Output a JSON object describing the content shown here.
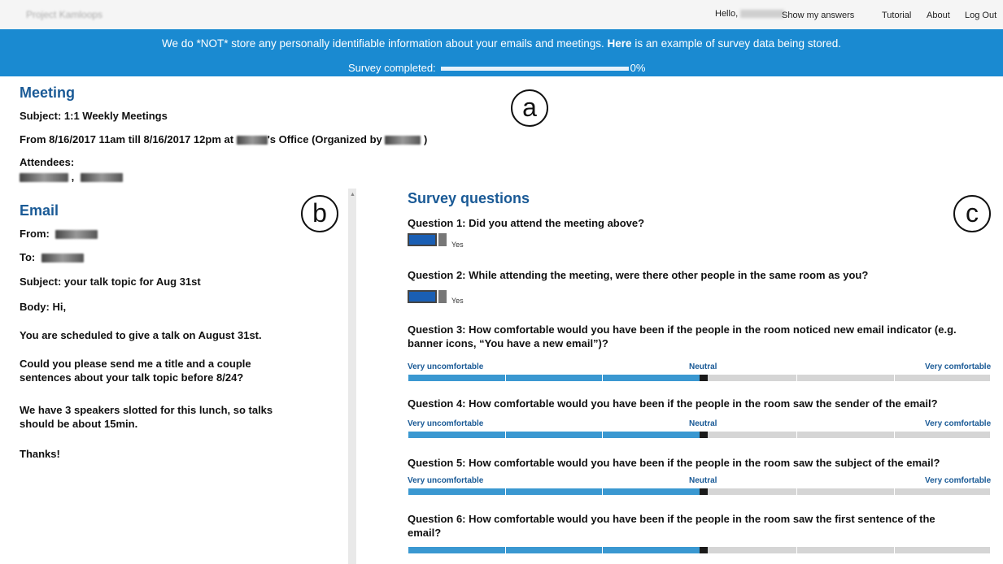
{
  "nav": {
    "brand": "Project Kamloops",
    "hello": "Hello,",
    "links": [
      "Show my answers",
      "Tutorial",
      "About",
      "Log Out"
    ]
  },
  "banner": {
    "notice_pre": "We do *NOT* store any personally identifiable information about your emails and meetings. ",
    "notice_link": "Here",
    "notice_post": " is an example of survey data being stored.",
    "progress_label": "Survey completed:",
    "progress_value": "0%",
    "progress_fraction": 0.0
  },
  "meeting": {
    "title": "Meeting",
    "subject": "Subject: 1:1 Weekly Meetings",
    "from_pre": "From 8/16/2017 11am till 8/16/2017 12pm at",
    "from_office": "'s Office (Organized by",
    "from_close": ")",
    "attendees_label": "Attendees:",
    "attendees_sep": ","
  },
  "annotations": [
    "a",
    "b",
    "c"
  ],
  "email": {
    "title": "Email",
    "from": "From:",
    "to": "To:",
    "subject": "Subject: your talk topic for Aug 31st",
    "body_label": "Body: Hi,",
    "p1": "You are scheduled to give a talk on August 31st.",
    "p2_line1": "Could you please send me a title and a couple",
    "p2_line2": "sentences about your talk topic before 8/24?",
    "p3_line1": "We have 3 speakers slotted for this lunch, so talks",
    "p3_line2": "should be about 15min.",
    "p4": "Thanks!"
  },
  "survey": {
    "title": "Survey questions",
    "scale": {
      "low": "Very uncomfortable",
      "mid": "Neutral",
      "high": "Very comfortable"
    },
    "slider_position": 0.5,
    "questions": [
      {
        "label": "Question 1:  Did you attend the meeting above?",
        "type": "toggle",
        "answer": "Yes"
      },
      {
        "label": "Question 2:  While attending the meeting, were there other people in the same room as you?",
        "type": "toggle",
        "answer": "Yes"
      },
      {
        "label": "Question 3:  How comfortable would you have been if the people in the room noticed new email indicator (e.g.",
        "label2": "banner icons, “You have a new email”)?",
        "type": "slider"
      },
      {
        "label": "Question 4:  How comfortable would you have been if the people in the room saw the sender of the email?",
        "type": "slider"
      },
      {
        "label": "Question 5:  How comfortable would you have been if the people in the room saw the subject of the email?",
        "type": "slider"
      },
      {
        "label": "Question 6:  How comfortable would you have been if the people in the room saw the first sentence of the",
        "label2": "email?",
        "type": "slider"
      }
    ]
  }
}
